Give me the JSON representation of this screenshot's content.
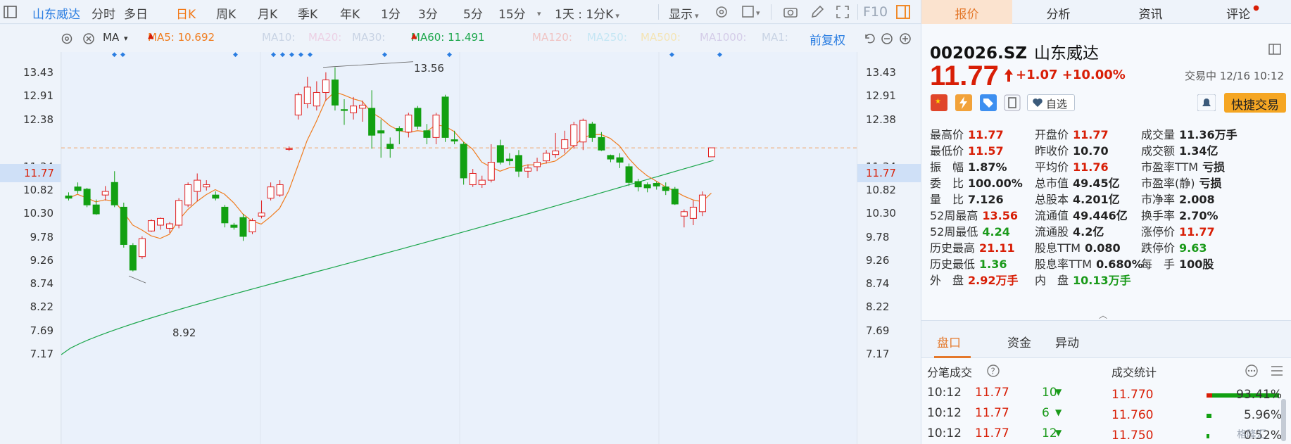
{
  "toolbar": {
    "stock_name": "山东威达",
    "periods": [
      "分时",
      "多日",
      "日K",
      "周K",
      "月K",
      "季K",
      "年K",
      "1分",
      "3分",
      "5分",
      "15分"
    ],
    "active_period": "日K",
    "interval_select": "1天 : 1分K",
    "display_label": "显示",
    "f10_label": "F10"
  },
  "indicators": {
    "ma_label": "MA",
    "ma5": "MA5: 10.692",
    "ma10": "MA10:",
    "ma20": "MA20:",
    "ma30": "MA30:",
    "ma60": "MA60: 11.491",
    "ma120": "MA120:",
    "ma250": "MA250:",
    "ma500": "MA500:",
    "ma1000": "MA1000:",
    "ma1": "MA1:",
    "adjust": "前复权",
    "colors": {
      "ma5": "#f07c1e",
      "ma60": "#1aa64a",
      "faded": "#c8d3e4"
    }
  },
  "axis": {
    "labels": [
      "13.43",
      "12.91",
      "12.38",
      "11.77",
      "11.34",
      "10.82",
      "10.30",
      "9.78",
      "9.26",
      "8.74",
      "8.22",
      "7.69",
      "7.17"
    ],
    "current": "11.77",
    "high_label": "13.56",
    "low_label": "8.92"
  },
  "chart_data": {
    "type": "candlestick",
    "candles": [
      [
        10.7,
        10.78,
        10.6,
        10.65
      ],
      [
        10.9,
        11.0,
        10.75,
        10.82
      ],
      [
        10.85,
        10.88,
        10.45,
        10.5
      ],
      [
        10.5,
        10.62,
        10.28,
        10.3
      ],
      [
        10.72,
        10.92,
        10.6,
        10.8
      ],
      [
        11.0,
        11.25,
        10.45,
        10.5
      ],
      [
        10.45,
        10.55,
        9.55,
        9.62
      ],
      [
        9.6,
        9.65,
        9.02,
        9.05
      ],
      [
        9.35,
        9.8,
        9.3,
        9.75
      ],
      [
        9.92,
        10.18,
        9.9,
        10.15
      ],
      [
        10.05,
        10.22,
        9.95,
        10.2
      ],
      [
        9.98,
        10.12,
        9.88,
        10.08
      ],
      [
        10.05,
        10.65,
        9.98,
        10.6
      ],
      [
        10.5,
        11.0,
        10.45,
        10.95
      ],
      [
        10.8,
        11.2,
        10.58,
        11.05
      ],
      [
        10.9,
        11.05,
        10.82,
        10.95
      ],
      [
        10.72,
        10.8,
        10.6,
        10.65
      ],
      [
        10.45,
        10.5,
        10.0,
        10.1
      ],
      [
        10.05,
        10.1,
        9.95,
        10.0
      ],
      [
        10.22,
        10.3,
        9.7,
        9.8
      ],
      [
        9.9,
        10.2,
        9.85,
        10.15
      ],
      [
        10.25,
        10.6,
        10.2,
        10.32
      ],
      [
        10.65,
        11.0,
        10.6,
        10.9
      ],
      [
        10.72,
        11.05,
        10.68,
        10.95
      ],
      [
        11.75,
        11.8,
        11.7,
        11.75
      ],
      [
        12.5,
        13.0,
        12.4,
        12.95
      ],
      [
        12.75,
        13.35,
        12.65,
        13.12
      ],
      [
        12.7,
        13.25,
        12.6,
        13.0
      ],
      [
        13.0,
        13.45,
        12.82,
        13.28
      ],
      [
        13.28,
        13.56,
        12.6,
        12.72
      ],
      [
        12.62,
        12.85,
        12.28,
        12.6
      ],
      [
        12.55,
        12.9,
        12.4,
        12.7
      ],
      [
        12.65,
        12.82,
        12.35,
        12.72
      ],
      [
        12.65,
        13.05,
        11.75,
        12.05
      ],
      [
        12.15,
        12.4,
        11.55,
        12.1
      ],
      [
        11.85,
        12.0,
        11.55,
        11.75
      ],
      [
        12.2,
        12.25,
        11.85,
        12.15
      ],
      [
        12.12,
        12.55,
        12.0,
        12.5
      ],
      [
        12.65,
        12.7,
        12.18,
        12.25
      ],
      [
        12.15,
        12.3,
        11.85,
        12.0
      ],
      [
        12.0,
        12.55,
        11.85,
        12.5
      ],
      [
        12.9,
        12.95,
        11.9,
        12.0
      ],
      [
        11.95,
        12.15,
        11.85,
        11.92
      ],
      [
        11.85,
        11.9,
        10.95,
        11.1
      ],
      [
        10.95,
        11.3,
        10.9,
        11.2
      ],
      [
        10.95,
        11.15,
        10.88,
        11.05
      ],
      [
        11.05,
        11.85,
        11.0,
        11.45
      ],
      [
        11.82,
        11.95,
        11.4,
        11.45
      ],
      [
        11.52,
        11.65,
        11.38,
        11.48
      ],
      [
        11.6,
        11.72,
        11.12,
        11.25
      ],
      [
        11.25,
        11.4,
        11.1,
        11.32
      ],
      [
        11.35,
        11.55,
        11.25,
        11.45
      ],
      [
        11.48,
        11.72,
        11.42,
        11.65
      ],
      [
        11.62,
        12.1,
        11.55,
        11.7
      ],
      [
        11.75,
        12.15,
        11.65,
        11.95
      ],
      [
        11.82,
        12.35,
        11.75,
        12.28
      ],
      [
        11.9,
        12.42,
        11.72,
        12.38
      ],
      [
        12.3,
        12.35,
        11.9,
        12.0
      ],
      [
        12.0,
        12.12,
        11.7,
        11.72
      ],
      [
        11.6,
        11.62,
        11.45,
        11.52
      ],
      [
        11.55,
        11.65,
        11.32,
        11.45
      ],
      [
        11.35,
        11.42,
        10.92,
        11.0
      ],
      [
        11.02,
        11.08,
        10.8,
        10.9
      ],
      [
        10.95,
        11.0,
        10.78,
        10.88
      ],
      [
        10.98,
        11.02,
        10.84,
        10.92
      ],
      [
        10.9,
        11.0,
        10.72,
        10.82
      ],
      [
        10.85,
        10.9,
        10.5,
        10.52
      ],
      [
        10.25,
        10.4,
        10.0,
        10.35
      ],
      [
        10.2,
        10.6,
        10.05,
        10.45
      ],
      [
        10.35,
        10.8,
        10.25,
        10.72
      ],
      [
        11.57,
        11.77,
        11.57,
        11.77
      ]
    ],
    "ma5_last": 10.692,
    "ma60_last": 11.491,
    "ylim": [
      7.0,
      13.7
    ]
  },
  "quote": {
    "code": "002026.SZ",
    "name": "山东威达",
    "price": "11.77",
    "change": "+1.07",
    "change_pct": "+10.00%",
    "status": "交易中 12/16 10:12",
    "watch_label": "自选",
    "trade_label": "快捷交易"
  },
  "right_tabs": [
    "报价",
    "分析",
    "资讯",
    "评论"
  ],
  "stats": [
    [
      [
        "最高价",
        "11.77",
        "red"
      ],
      [
        "开盘价",
        "11.77",
        "red"
      ],
      [
        "成交量",
        "11.36万手",
        "dark"
      ]
    ],
    [
      [
        "最低价",
        "11.57",
        "red"
      ],
      [
        "昨收价",
        "10.70",
        "dark"
      ],
      [
        "成交额",
        "1.34亿",
        "dark"
      ]
    ],
    [
      [
        "振　幅",
        "1.87%",
        "dark"
      ],
      [
        "平均价",
        "11.76",
        "red"
      ],
      [
        "市盈率TTM",
        "亏损",
        "dark"
      ]
    ],
    [
      [
        "委　比",
        "100.00%",
        "dark"
      ],
      [
        "总市值",
        "49.45亿",
        "dark"
      ],
      [
        "市盈率(静)",
        "亏损",
        "dark"
      ]
    ],
    [
      [
        "量　比",
        "7.126",
        "dark"
      ],
      [
        "总股本",
        "4.201亿",
        "dark"
      ],
      [
        "市净率",
        "2.008",
        "dark"
      ]
    ],
    [
      [
        "52周最高",
        "13.56",
        "red"
      ],
      [
        "流通值",
        "49.446亿",
        "dark"
      ],
      [
        "换手率",
        "2.70%",
        "dark"
      ]
    ],
    [
      [
        "52周最低",
        "4.24",
        "green"
      ],
      [
        "流通股",
        "4.2亿",
        "dark"
      ],
      [
        "涨停价",
        "11.77",
        "red"
      ]
    ],
    [
      [
        "历史最高",
        "21.11",
        "red"
      ],
      [
        "股息TTM",
        "0.080",
        "dark"
      ],
      [
        "跌停价",
        "9.63",
        "green"
      ]
    ],
    [
      [
        "历史最低",
        "1.36",
        "green"
      ],
      [
        "股息率TTM",
        "0.680%",
        "dark"
      ],
      [
        "每　手",
        "100股",
        "dark"
      ]
    ],
    [
      [
        "外　盘",
        "2.92万手",
        "red"
      ],
      [
        "内　盘",
        "10.13万手",
        "green"
      ],
      [
        "",
        "",
        " "
      ]
    ]
  ],
  "sub_tabs": [
    "盘口",
    "资金",
    "异动"
  ],
  "ticks_header": "分笔成交",
  "stats_header": "成交统计",
  "ticks": [
    [
      "10:12",
      "11.77",
      "10"
    ],
    [
      "10:12",
      "11.77",
      "6"
    ],
    [
      "10:12",
      "11.77",
      "12"
    ]
  ],
  "dist": [
    [
      "11.770",
      "93.41%",
      0.934
    ],
    [
      "11.760",
      "5.96%",
      0.06
    ],
    [
      "11.750",
      "0.52%",
      0.005
    ]
  ],
  "watermark": "格隆汇"
}
